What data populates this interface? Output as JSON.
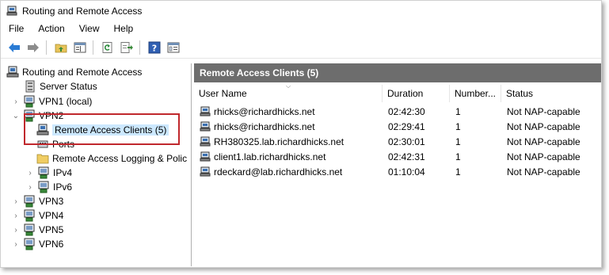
{
  "window": {
    "title": "Routing and Remote Access"
  },
  "menu": [
    "File",
    "Action",
    "View",
    "Help"
  ],
  "toolbar": {
    "buttons": [
      "back-icon",
      "forward-icon",
      "up-folder-icon",
      "show-hide-tree-icon",
      "refresh-icon",
      "export-list-icon",
      "help-icon",
      "properties-icon"
    ]
  },
  "tree": {
    "root": "Routing and Remote Access",
    "server_status": "Server Status",
    "vpn1": "VPN1 (local)",
    "vpn2": "VPN2",
    "remote_access_clients": "Remote Access Clients (5)",
    "ports": "Ports",
    "logging": "Remote Access Logging & Polic",
    "ipv4": "IPv4",
    "ipv6": "IPv6",
    "vpn3": "VPN3",
    "vpn4": "VPN4",
    "vpn5": "VPN5",
    "vpn6": "VPN6"
  },
  "main": {
    "header": "Remote Access Clients (5)",
    "columns": [
      "User Name",
      "Duration",
      "Number...",
      "Status"
    ],
    "rows": [
      {
        "user": "rhicks@richardhicks.net",
        "duration": "02:42:30",
        "number": "1",
        "status": "Not NAP-capable"
      },
      {
        "user": "rhicks@richardhicks.net",
        "duration": "02:29:41",
        "number": "1",
        "status": "Not NAP-capable"
      },
      {
        "user": "RH380325.lab.richardhicks.net",
        "duration": "02:30:01",
        "number": "1",
        "status": "Not NAP-capable"
      },
      {
        "user": "client1.lab.richardhicks.net",
        "duration": "02:42:31",
        "number": "1",
        "status": "Not NAP-capable"
      },
      {
        "user": "rdeckard@lab.richardhicks.net",
        "duration": "01:10:04",
        "number": "1",
        "status": "Not NAP-capable"
      }
    ]
  },
  "colors": {
    "header_bg": "#6d6d6d",
    "selection": "#cce8ff",
    "callout": "#c0282d"
  }
}
